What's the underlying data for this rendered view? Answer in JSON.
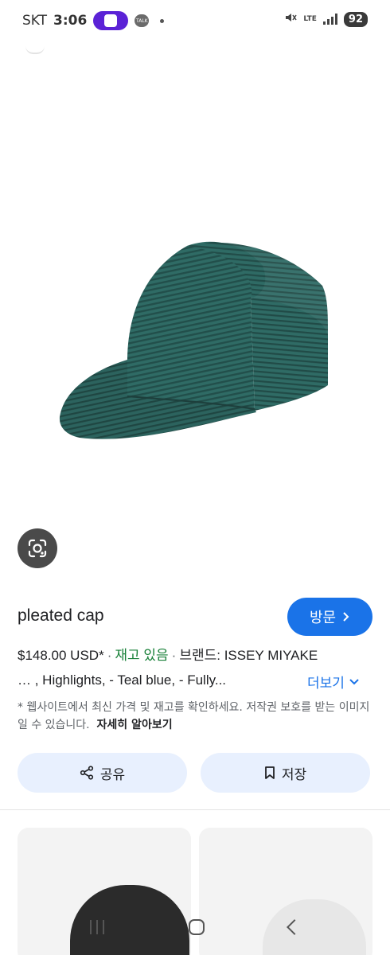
{
  "status_bar": {
    "carrier": "SKT",
    "time": "3:06",
    "talk_label": "TALK",
    "network": "LTE",
    "battery": "92"
  },
  "product": {
    "title": "pleated cap",
    "visit_label": "방문",
    "price": "$148.00 USD*",
    "stock": "재고 있음",
    "brand": "브랜드: ISSEY MIYAKE",
    "description": "… , Highlights, - Teal blue, - Fully...",
    "more_label": "더보기",
    "note": "* 웹사이트에서 최신 가격 및 재고를 확인하세요. 저작권 보호를 받는 이미지일 수 있습니다.",
    "learn_more": "자세히 알아보기"
  },
  "actions": {
    "share_label": "공유",
    "save_label": "저장"
  },
  "colors": {
    "accent": "#1a73e8",
    "stock_green": "#188038",
    "button_bg": "#e8f0fe",
    "cap_teal": "#2f6b65"
  }
}
